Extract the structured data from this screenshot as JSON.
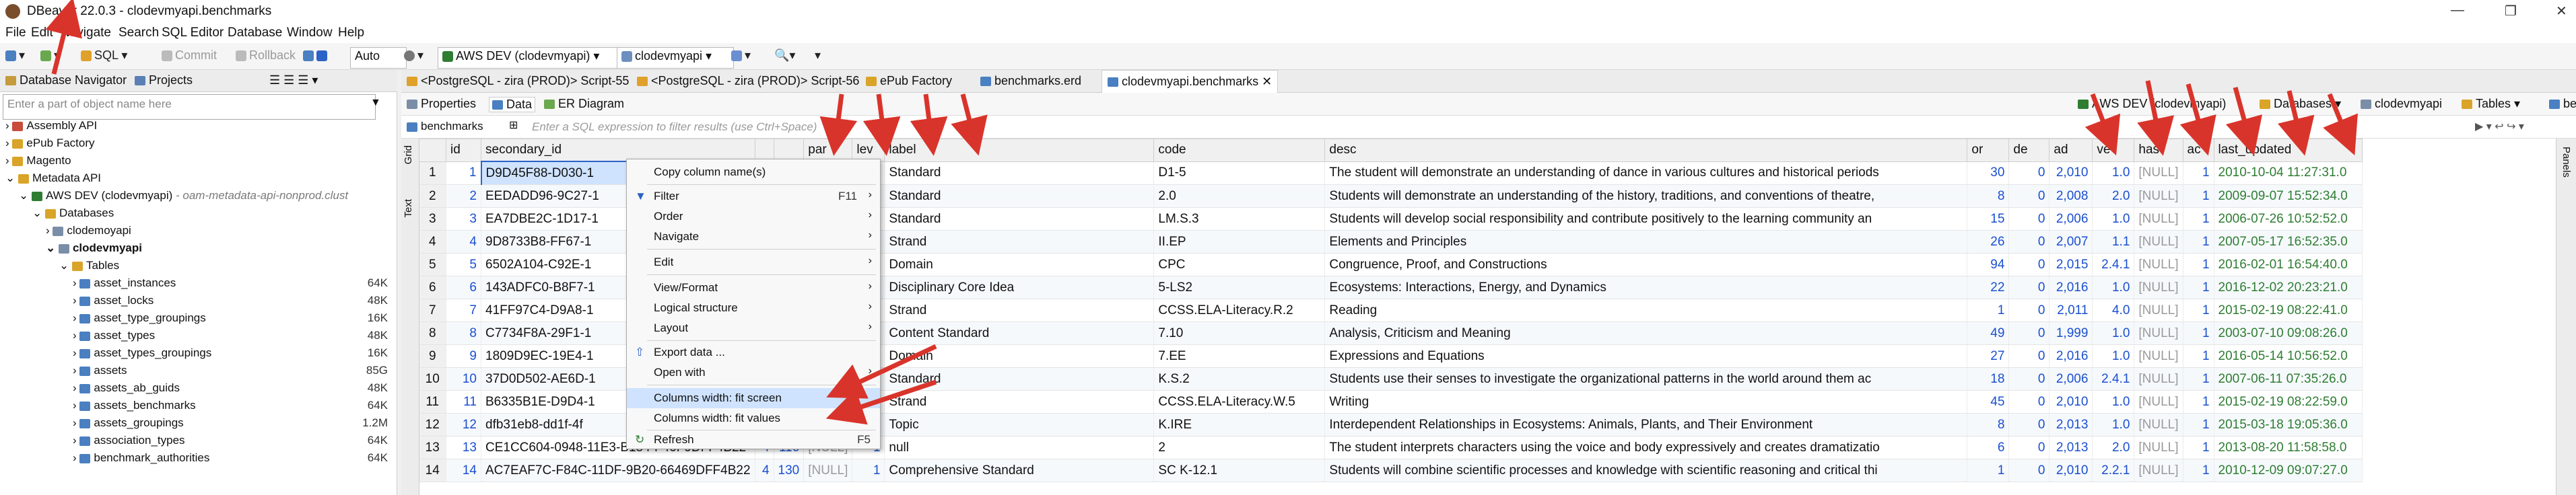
{
  "window": {
    "title": "DBeaver 22.0.3 - clodevmyapi.benchmarks"
  },
  "menu": [
    "File",
    "Edit",
    "Navigate",
    "Search",
    "SQL Editor",
    "Database",
    "Window",
    "Help"
  ],
  "toolbar": {
    "sql": "SQL",
    "commit": "Commit",
    "rollback": "Rollback",
    "auto": "Auto",
    "connection": "AWS DEV (clodevmyapi)",
    "schema": "clodevmyapi"
  },
  "nav": {
    "tabs": [
      "Database Navigator",
      "Projects"
    ],
    "search_placeholder": "Enter a part of object name here",
    "items": [
      {
        "label": "Assembly API",
        "size": ""
      },
      {
        "label": "ePub Factory",
        "size": ""
      },
      {
        "label": "Magento",
        "size": ""
      },
      {
        "label": "Metadata API",
        "size": ""
      },
      {
        "label": "AWS DEV (clodevmyapi)",
        "extra": " - oam-metadata-api-nonprod.clust",
        "size": ""
      },
      {
        "label": "Databases",
        "size": ""
      },
      {
        "label": "clodemoyapi",
        "size": ""
      },
      {
        "label": "clodevmyapi",
        "size": ""
      },
      {
        "label": "Tables",
        "size": ""
      },
      {
        "label": "asset_instances",
        "size": "64K"
      },
      {
        "label": "asset_locks",
        "size": "48K"
      },
      {
        "label": "asset_type_groupings",
        "size": "16K"
      },
      {
        "label": "asset_types",
        "size": "48K"
      },
      {
        "label": "asset_types_groupings",
        "size": "16K"
      },
      {
        "label": "assets",
        "size": "85G"
      },
      {
        "label": "assets_ab_guids",
        "size": "48K"
      },
      {
        "label": "assets_benchmarks",
        "size": "64K"
      },
      {
        "label": "assets_groupings",
        "size": "1.2M"
      },
      {
        "label": "association_types",
        "size": "64K"
      },
      {
        "label": "benchmark_authorities",
        "size": "64K"
      }
    ]
  },
  "editor_tabs": [
    "<PostgreSQL - zira (PROD)> Script-55",
    "<PostgreSQL - zira (PROD)> Script-56",
    "ePub Factory",
    "benchmarks.erd",
    "clodevmyapi.benchmarks"
  ],
  "sub_tabs": [
    "Properties",
    "Data",
    "ER Diagram"
  ],
  "right_toolbar": [
    "AWS DEV (clodevmyapi)",
    "Databases",
    "clodevmyapi",
    "Tables",
    "benchmarks"
  ],
  "filter": {
    "table": "benchmarks",
    "placeholder": "Enter a SQL expression to filter results (use Ctrl+Space)"
  },
  "side_labels": {
    "grid": "Grid",
    "text": "Text",
    "panels": "Panels"
  },
  "grid": {
    "columns": [
      "id",
      "secondary_id",
      "",
      "",
      "par",
      "lev",
      "label",
      "code",
      "desc",
      "or",
      "de",
      "ad",
      "ve",
      "has",
      "ac",
      "last_updated"
    ],
    "rows": [
      {
        "n": "1",
        "id": "1",
        "sid": "D9D45F88-D030-1",
        "c3": "",
        "c4": "",
        "par": "[NULL]",
        "lev": "1",
        "label": "Standard",
        "code": "D1-5",
        "desc": "The student will demonstrate an understanding of dance in various cultures and historical periods",
        "or": "30",
        "de": "0",
        "ad": "2,010",
        "ve": "1.0",
        "has": "[NULL]",
        "ac": "1",
        "lu": "2010-10-04 11:27:31.0"
      },
      {
        "n": "2",
        "id": "2",
        "sid": "EEDADD96-9C27-1",
        "c3": "",
        "c4": "",
        "par": "[NULL]",
        "lev": "1",
        "label": "Standard",
        "code": "2.0",
        "desc": "Students will demonstrate an understanding of the history, traditions, and conventions of theatre,",
        "or": "8",
        "de": "0",
        "ad": "2,008",
        "ve": "2.0",
        "has": "[NULL]",
        "ac": "1",
        "lu": "2009-09-07 15:52:34.0"
      },
      {
        "n": "3",
        "id": "3",
        "sid": "EA7DBE2C-1D17-1",
        "c3": "",
        "c4": "",
        "par": "[NULL]",
        "lev": "1",
        "label": "Standard",
        "code": "LM.S.3",
        "desc": "Students will develop social responsibility and contribute positively to the learning community an",
        "or": "15",
        "de": "0",
        "ad": "2,006",
        "ve": "1.0",
        "has": "[NULL]",
        "ac": "1",
        "lu": "2006-07-26 10:52:52.0"
      },
      {
        "n": "4",
        "id": "4",
        "sid": "9D8733B8-FF67-1",
        "c3": "",
        "c4": "",
        "par": "[NULL]",
        "lev": "1",
        "label": "Strand",
        "code": "II.EP",
        "desc": "Elements and Principles",
        "or": "26",
        "de": "0",
        "ad": "2,007",
        "ve": "1.1",
        "has": "[NULL]",
        "ac": "1",
        "lu": "2007-05-17 16:52:35.0"
      },
      {
        "n": "5",
        "id": "5",
        "sid": "6502A104-C92E-1",
        "c3": "",
        "c4": "",
        "par": "[NULL]",
        "lev": "1",
        "label": "Domain",
        "code": "CPC",
        "desc": "Congruence, Proof, and Constructions",
        "or": "94",
        "de": "0",
        "ad": "2,015",
        "ve": "2.4.1",
        "has": "[NULL]",
        "ac": "1",
        "lu": "2016-02-01 16:54:40.0"
      },
      {
        "n": "6",
        "id": "6",
        "sid": "143ADFC0-B8F7-1",
        "c3": "",
        "c4": "",
        "par": "[NULL]",
        "lev": "1",
        "label": "Disciplinary Core Idea",
        "code": "5-LS2",
        "desc": "Ecosystems: Interactions, Energy, and Dynamics",
        "or": "22",
        "de": "0",
        "ad": "2,016",
        "ve": "1.0",
        "has": "[NULL]",
        "ac": "1",
        "lu": "2016-12-02 20:23:21.0"
      },
      {
        "n": "7",
        "id": "7",
        "sid": "41FF97C4-D9A8-1",
        "c3": "",
        "c4": "",
        "par": "[NULL]",
        "lev": "1",
        "label": "Strand",
        "code": "CCSS.ELA-Literacy.R.2",
        "desc": "Reading",
        "or": "1",
        "de": "0",
        "ad": "2,011",
        "ve": "4.0",
        "has": "[NULL]",
        "ac": "1",
        "lu": "2015-02-19 08:22:41.0"
      },
      {
        "n": "8",
        "id": "8",
        "sid": "C7734F8A-29F1-1",
        "c3": "",
        "c4": "",
        "par": "[NULL]",
        "lev": "1",
        "label": "Content Standard",
        "code": "7.10",
        "desc": "Analysis, Criticism and Meaning",
        "or": "49",
        "de": "0",
        "ad": "1,999",
        "ve": "1.0",
        "has": "[NULL]",
        "ac": "1",
        "lu": "2003-07-10 09:08:26.0"
      },
      {
        "n": "9",
        "id": "9",
        "sid": "1809D9EC-19E4-1",
        "c3": "",
        "c4": "",
        "par": "[NULL]",
        "lev": "1",
        "label": "Domain",
        "code": "7.EE",
        "desc": "Expressions and Equations",
        "or": "27",
        "de": "0",
        "ad": "2,016",
        "ve": "1.0",
        "has": "[NULL]",
        "ac": "1",
        "lu": "2016-05-14 10:56:52.0"
      },
      {
        "n": "10",
        "id": "10",
        "sid": "37D0D502-AE6D-1",
        "c3": "",
        "c4": "",
        "par": "[NULL]",
        "lev": "1",
        "label": "Standard",
        "code": "K.S.2",
        "desc": "Students use their senses to investigate the organizational patterns in the world around them ac",
        "or": "18",
        "de": "0",
        "ad": "2,006",
        "ve": "2.4.1",
        "has": "[NULL]",
        "ac": "1",
        "lu": "2007-06-11 07:35:26.0"
      },
      {
        "n": "11",
        "id": "11",
        "sid": "B6335B1E-D9D4-1",
        "c3": "",
        "c4": "",
        "par": "[NULL]",
        "lev": "1",
        "label": "Strand",
        "code": "CCSS.ELA-Literacy.W.5",
        "desc": "Writing",
        "or": "45",
        "de": "0",
        "ad": "2,010",
        "ve": "1.0",
        "has": "[NULL]",
        "ac": "1",
        "lu": "2015-02-19 08:22:59.0"
      },
      {
        "n": "12",
        "id": "12",
        "sid": "dfb31eb8-dd1f-4f",
        "c3": "",
        "c4": "",
        "par": "[NULL]",
        "lev": "1",
        "label": "Topic",
        "code": "K.IRE",
        "desc": "Interdependent Relationships in Ecosystems: Animals, Plants, and Their Environment",
        "or": "8",
        "de": "0",
        "ad": "2,013",
        "ve": "1.0",
        "has": "[NULL]",
        "ac": "1",
        "lu": "2015-03-18 19:05:36.0"
      },
      {
        "n": "13",
        "id": "13",
        "sid": "CE1CC604-0948-11E3-B154-F40F9DFF4B22",
        "c3": "4",
        "c4": "116",
        "par": "[NULL]",
        "lev": "1",
        "label": "null",
        "code": "2",
        "desc": "The student interprets characters using the voice and body expressively and creates dramatizatio",
        "or": "6",
        "de": "0",
        "ad": "2,013",
        "ve": "2.0",
        "has": "[NULL]",
        "ac": "1",
        "lu": "2013-08-20 11:58:58.0"
      },
      {
        "n": "14",
        "id": "14",
        "sid": "AC7EAF7C-F84C-11DF-9B20-66469DFF4B22",
        "c3": "4",
        "c4": "130",
        "par": "[NULL]",
        "lev": "1",
        "label": "Comprehensive Standard",
        "code": "SC K-12.1",
        "desc": "Students will combine scientific processes and knowledge with scientific reasoning and critical thi",
        "or": "1",
        "de": "0",
        "ad": "2,010",
        "ve": "2.2.1",
        "has": "[NULL]",
        "ac": "1",
        "lu": "2010-12-09 09:07:27.0"
      }
    ]
  },
  "context_menu": {
    "items": [
      {
        "label": "Copy column name(s)",
        "key": "",
        "submenu": false
      },
      {
        "label": "Filter",
        "key": "F11",
        "submenu": true
      },
      {
        "label": "Order",
        "key": "",
        "submenu": true
      },
      {
        "label": "Navigate",
        "key": "",
        "submenu": true
      },
      {
        "label": "Edit",
        "key": "",
        "submenu": true
      },
      {
        "label": "View/Format",
        "key": "",
        "submenu": true
      },
      {
        "label": "Logical structure",
        "key": "",
        "submenu": true
      },
      {
        "label": "Layout",
        "key": "",
        "submenu": true
      },
      {
        "label": "Export data ...",
        "key": "",
        "submenu": false
      },
      {
        "label": "Open with",
        "key": "",
        "submenu": true
      },
      {
        "label": "Columns width: fit screen",
        "key": "",
        "submenu": false
      },
      {
        "label": "Columns width: fit values",
        "key": "",
        "submenu": false
      },
      {
        "label": "Refresh",
        "key": "F5",
        "submenu": false
      }
    ]
  },
  "colors": {
    "accent": "#2d62c8",
    "arrow": "#d9342b",
    "number": "#1a4fd0",
    "date": "#2e7d32",
    "null": "#9a9a9a"
  }
}
